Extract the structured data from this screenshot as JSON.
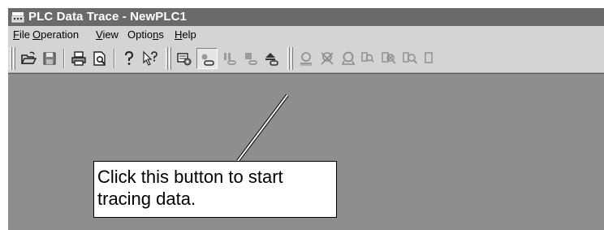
{
  "window": {
    "title": "PLC Data Trace - NewPLC1",
    "icon": "plc-app-icon"
  },
  "menu": {
    "items": [
      {
        "label_first": "F",
        "label_rest": "ile"
      },
      {
        "label_first": "O",
        "label_rest": "peration"
      },
      {
        "label_first": "V",
        "label_rest": "iew"
      },
      {
        "label_prefix": "Optio",
        "label_first": "n",
        "label_rest": "s"
      },
      {
        "label_first": "H",
        "label_rest": "elp"
      }
    ]
  },
  "toolbar": {
    "buttons": [
      "open-icon",
      "save-icon",
      "print-icon",
      "print-preview-icon",
      "help-icon",
      "context-help-icon",
      "plc-settings-icon",
      "start-trace-icon",
      "pause-trace-icon",
      "stop-trace-icon",
      "upload-trace-icon",
      "zoom-icon",
      "zoom-cancel-icon",
      "zoom-fit-icon",
      "zoom-x-icon",
      "zoom-x-cancel-icon",
      "zoom-y-icon"
    ]
  },
  "callout": {
    "line1": "Click this button to start",
    "line2": "tracing data."
  },
  "colors": {
    "titlebar": "#6a6a6a",
    "chrome": "#d4d4d4",
    "workspace": "#8e8e8e"
  }
}
